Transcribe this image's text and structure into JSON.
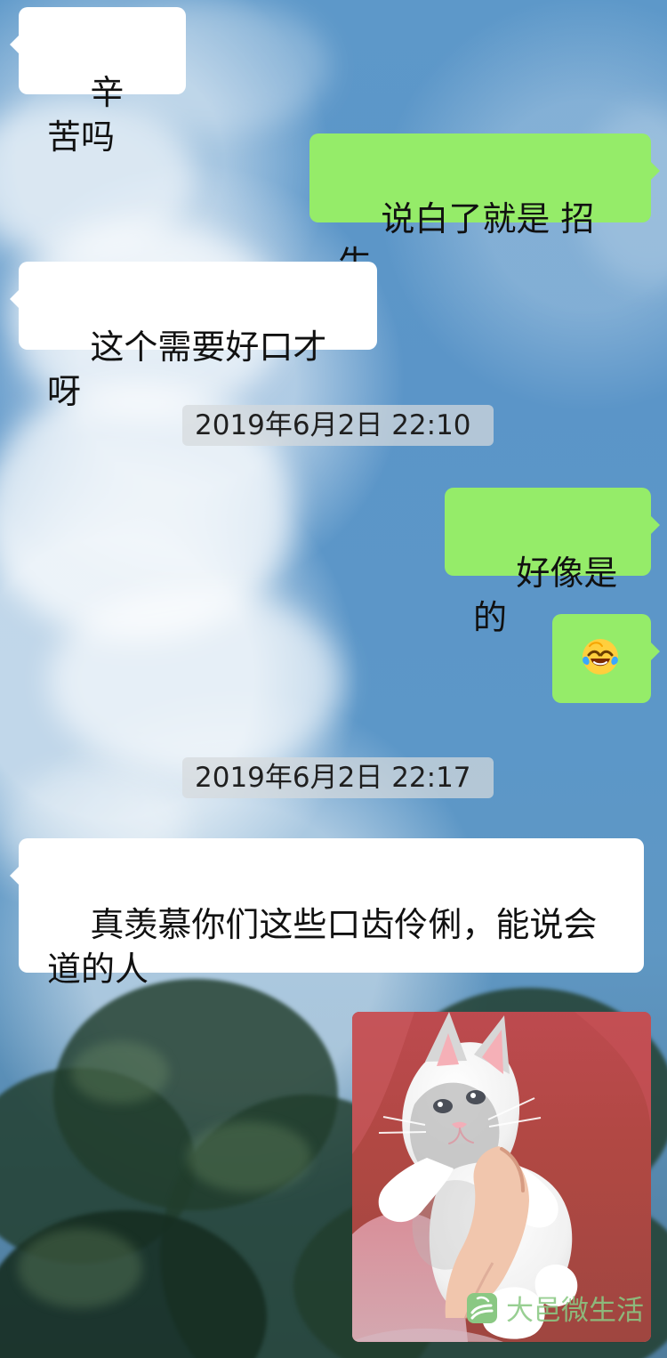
{
  "messages": [
    {
      "side": "left",
      "text": "辛苦吗"
    },
    {
      "side": "right",
      "text": "说白了就是 招生"
    },
    {
      "side": "left",
      "text": "这个需要好口才呀"
    },
    {
      "timestamp": "2019年6月2日 22:10"
    },
    {
      "side": "right",
      "text": "好像是的"
    },
    {
      "side": "right",
      "emoji": "laughing-crying-emoji"
    },
    {
      "timestamp": "2019年6月2日 22:17"
    },
    {
      "side": "left",
      "text": "真羡慕你们这些口齿伶俐，能说会\n道的人"
    },
    {
      "side": "right",
      "image": "cat-photo"
    }
  ],
  "watermark": {
    "text": "大邑微生活"
  },
  "colors": {
    "incoming_bubble": "#ffffff",
    "outgoing_bubble": "#95ec69",
    "timestamp_bg": "#d6dadc",
    "watermark": "#8ac883"
  }
}
